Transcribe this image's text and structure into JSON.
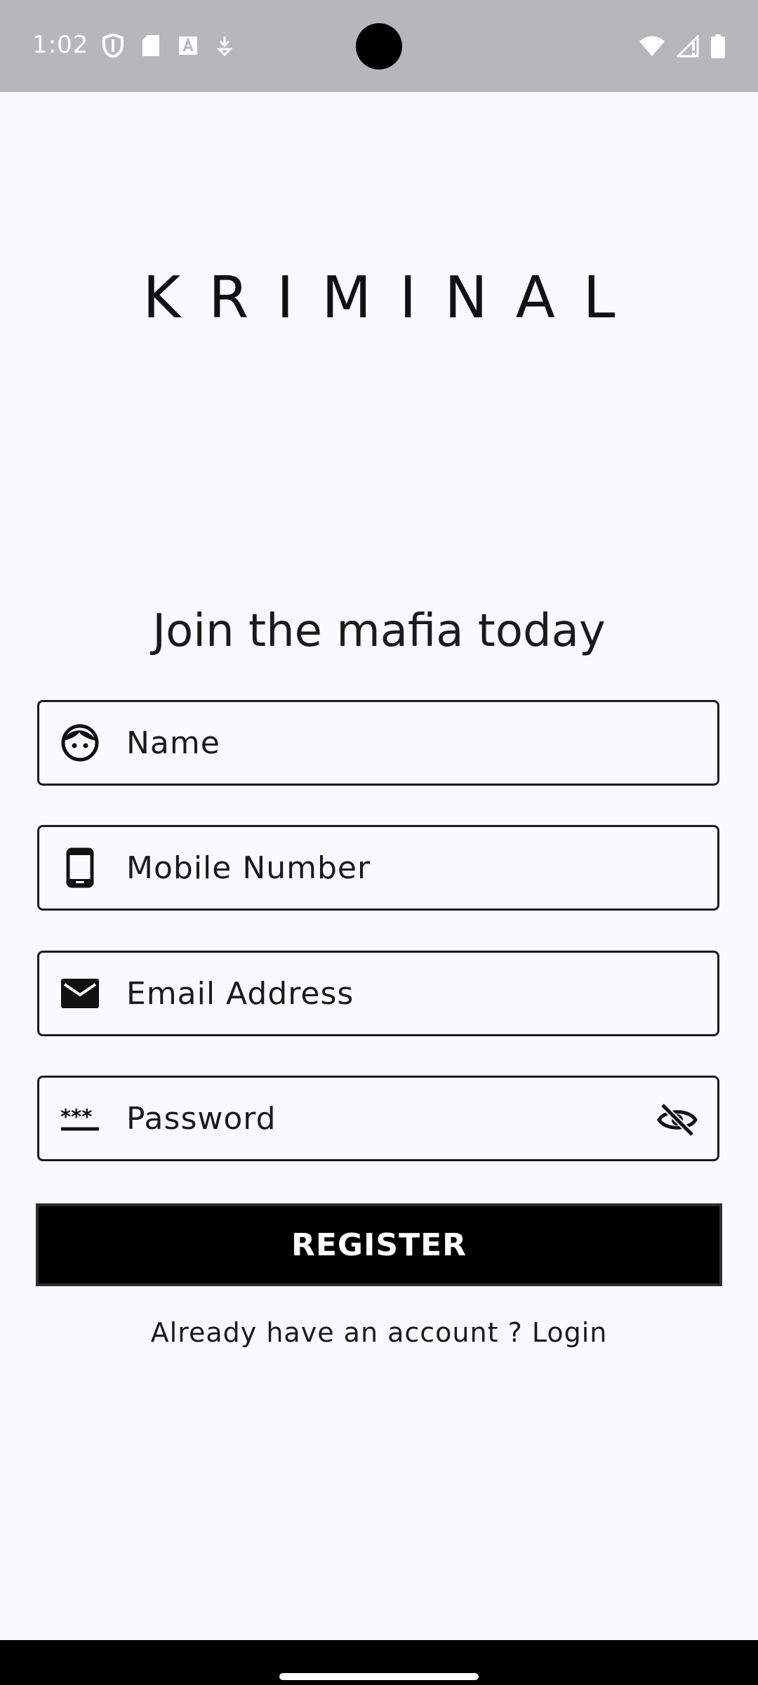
{
  "status_bar": {
    "time": "1:02",
    "icons_left": [
      "shield-icon",
      "sd-card-icon",
      "font-a-icon",
      "download-icon"
    ],
    "icons_right": [
      "wifi-icon",
      "signal-icon",
      "battery-icon"
    ]
  },
  "app": {
    "title": "KRIMINAL",
    "headline": "Join the mafia today"
  },
  "form": {
    "name": {
      "placeholder": "Name",
      "icon": "face-icon"
    },
    "mobile": {
      "placeholder": "Mobile Number",
      "icon": "phone-icon"
    },
    "email": {
      "placeholder": "Email Address",
      "icon": "mail-icon"
    },
    "password": {
      "placeholder": "Password",
      "icon": "password-icon",
      "toggle_icon": "visibility-off-icon"
    }
  },
  "actions": {
    "register_label": "REGISTER",
    "login_prompt": "Already have an account ? Login"
  }
}
